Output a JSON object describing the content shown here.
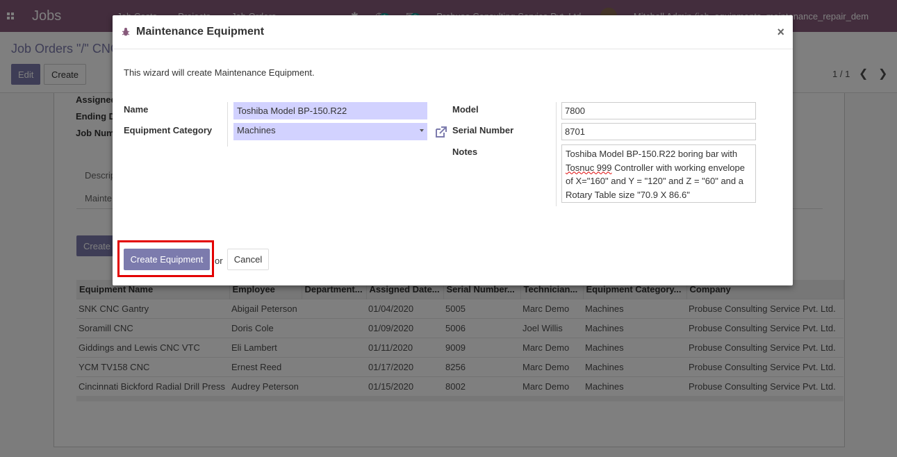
{
  "navbar": {
    "brand": "Jobs",
    "menu": [
      "Job Costs",
      "Projects",
      "Job Orders"
    ],
    "company": "Probuse Consulting Service Pvt. Ltd.",
    "user": "Mitchell Admin (job_equipments_maintenance_repair_dem",
    "activity_count": "1",
    "message_count": "3"
  },
  "control_panel": {
    "breadcrumb": "Job Orders \"/\" CNC",
    "edit_label": "Edit",
    "create_label": "Create",
    "pager": "1 / 1"
  },
  "sheet": {
    "labels": [
      "Assigned",
      "Ending D",
      "Job Num"
    ],
    "tabs": [
      "Descrip",
      "Mainte"
    ],
    "create_equipment_label": "Create"
  },
  "equipment_list": {
    "columns": [
      "Equipment Name",
      "Employee",
      "Department...",
      "Assigned Date...",
      "Serial Number...",
      "Technician...",
      "Equipment Category...",
      "Company"
    ],
    "rows": [
      [
        "SNK CNC Gantry",
        "Abigail Peterson",
        "",
        "01/04/2020",
        "5005",
        "Marc Demo",
        "Machines",
        "Probuse Consulting Service Pvt. Ltd."
      ],
      [
        "Soramill CNC",
        "Doris Cole",
        "",
        "01/09/2020",
        "5006",
        "Joel Willis",
        "Machines",
        "Probuse Consulting Service Pvt. Ltd."
      ],
      [
        "Giddings and Lewis CNC VTC",
        "Eli Lambert",
        "",
        "01/11/2020",
        "9009",
        "Marc Demo",
        "Machines",
        "Probuse Consulting Service Pvt. Ltd."
      ],
      [
        "YCM TV158 CNC",
        "Ernest Reed",
        "",
        "01/17/2020",
        "8256",
        "Marc Demo",
        "Machines",
        "Probuse Consulting Service Pvt. Ltd."
      ],
      [
        "Cincinnati Bickford Radial Drill Press",
        "Audrey Peterson",
        "",
        "01/15/2020",
        "8002",
        "Marc Demo",
        "Machines",
        "Probuse Consulting Service Pvt. Ltd."
      ]
    ]
  },
  "modal": {
    "title": "Maintenance Equipment",
    "close": "×",
    "intro": "This wizard will create Maintenance Equipment.",
    "name_label": "Name",
    "name_value": "Toshiba Model BP-150.R22",
    "category_label": "Equipment Category",
    "category_value": "Machines",
    "model_label": "Model",
    "model_value": "7800",
    "serial_label": "Serial Number",
    "serial_value": "8701",
    "notes_label": "Notes",
    "notes_lines": [
      "Toshiba Model BP-150.R22 boring bar with",
      "Controller with working envelope",
      "of X=\"160\" and  Y = \"120\" and Z = \"60\" and a",
      "Rotary Table size \"70.9 X 86.6\""
    ],
    "notes_misspelled_word": "Tosnuc 999",
    "create_button": "Create Equipment",
    "or_text": "or",
    "cancel_button": "Cancel"
  },
  "colors": {
    "navbar": "#875a7b",
    "primary": "#7c7bad",
    "required_field": "#d2d2ff",
    "highlight": "#e30000"
  }
}
